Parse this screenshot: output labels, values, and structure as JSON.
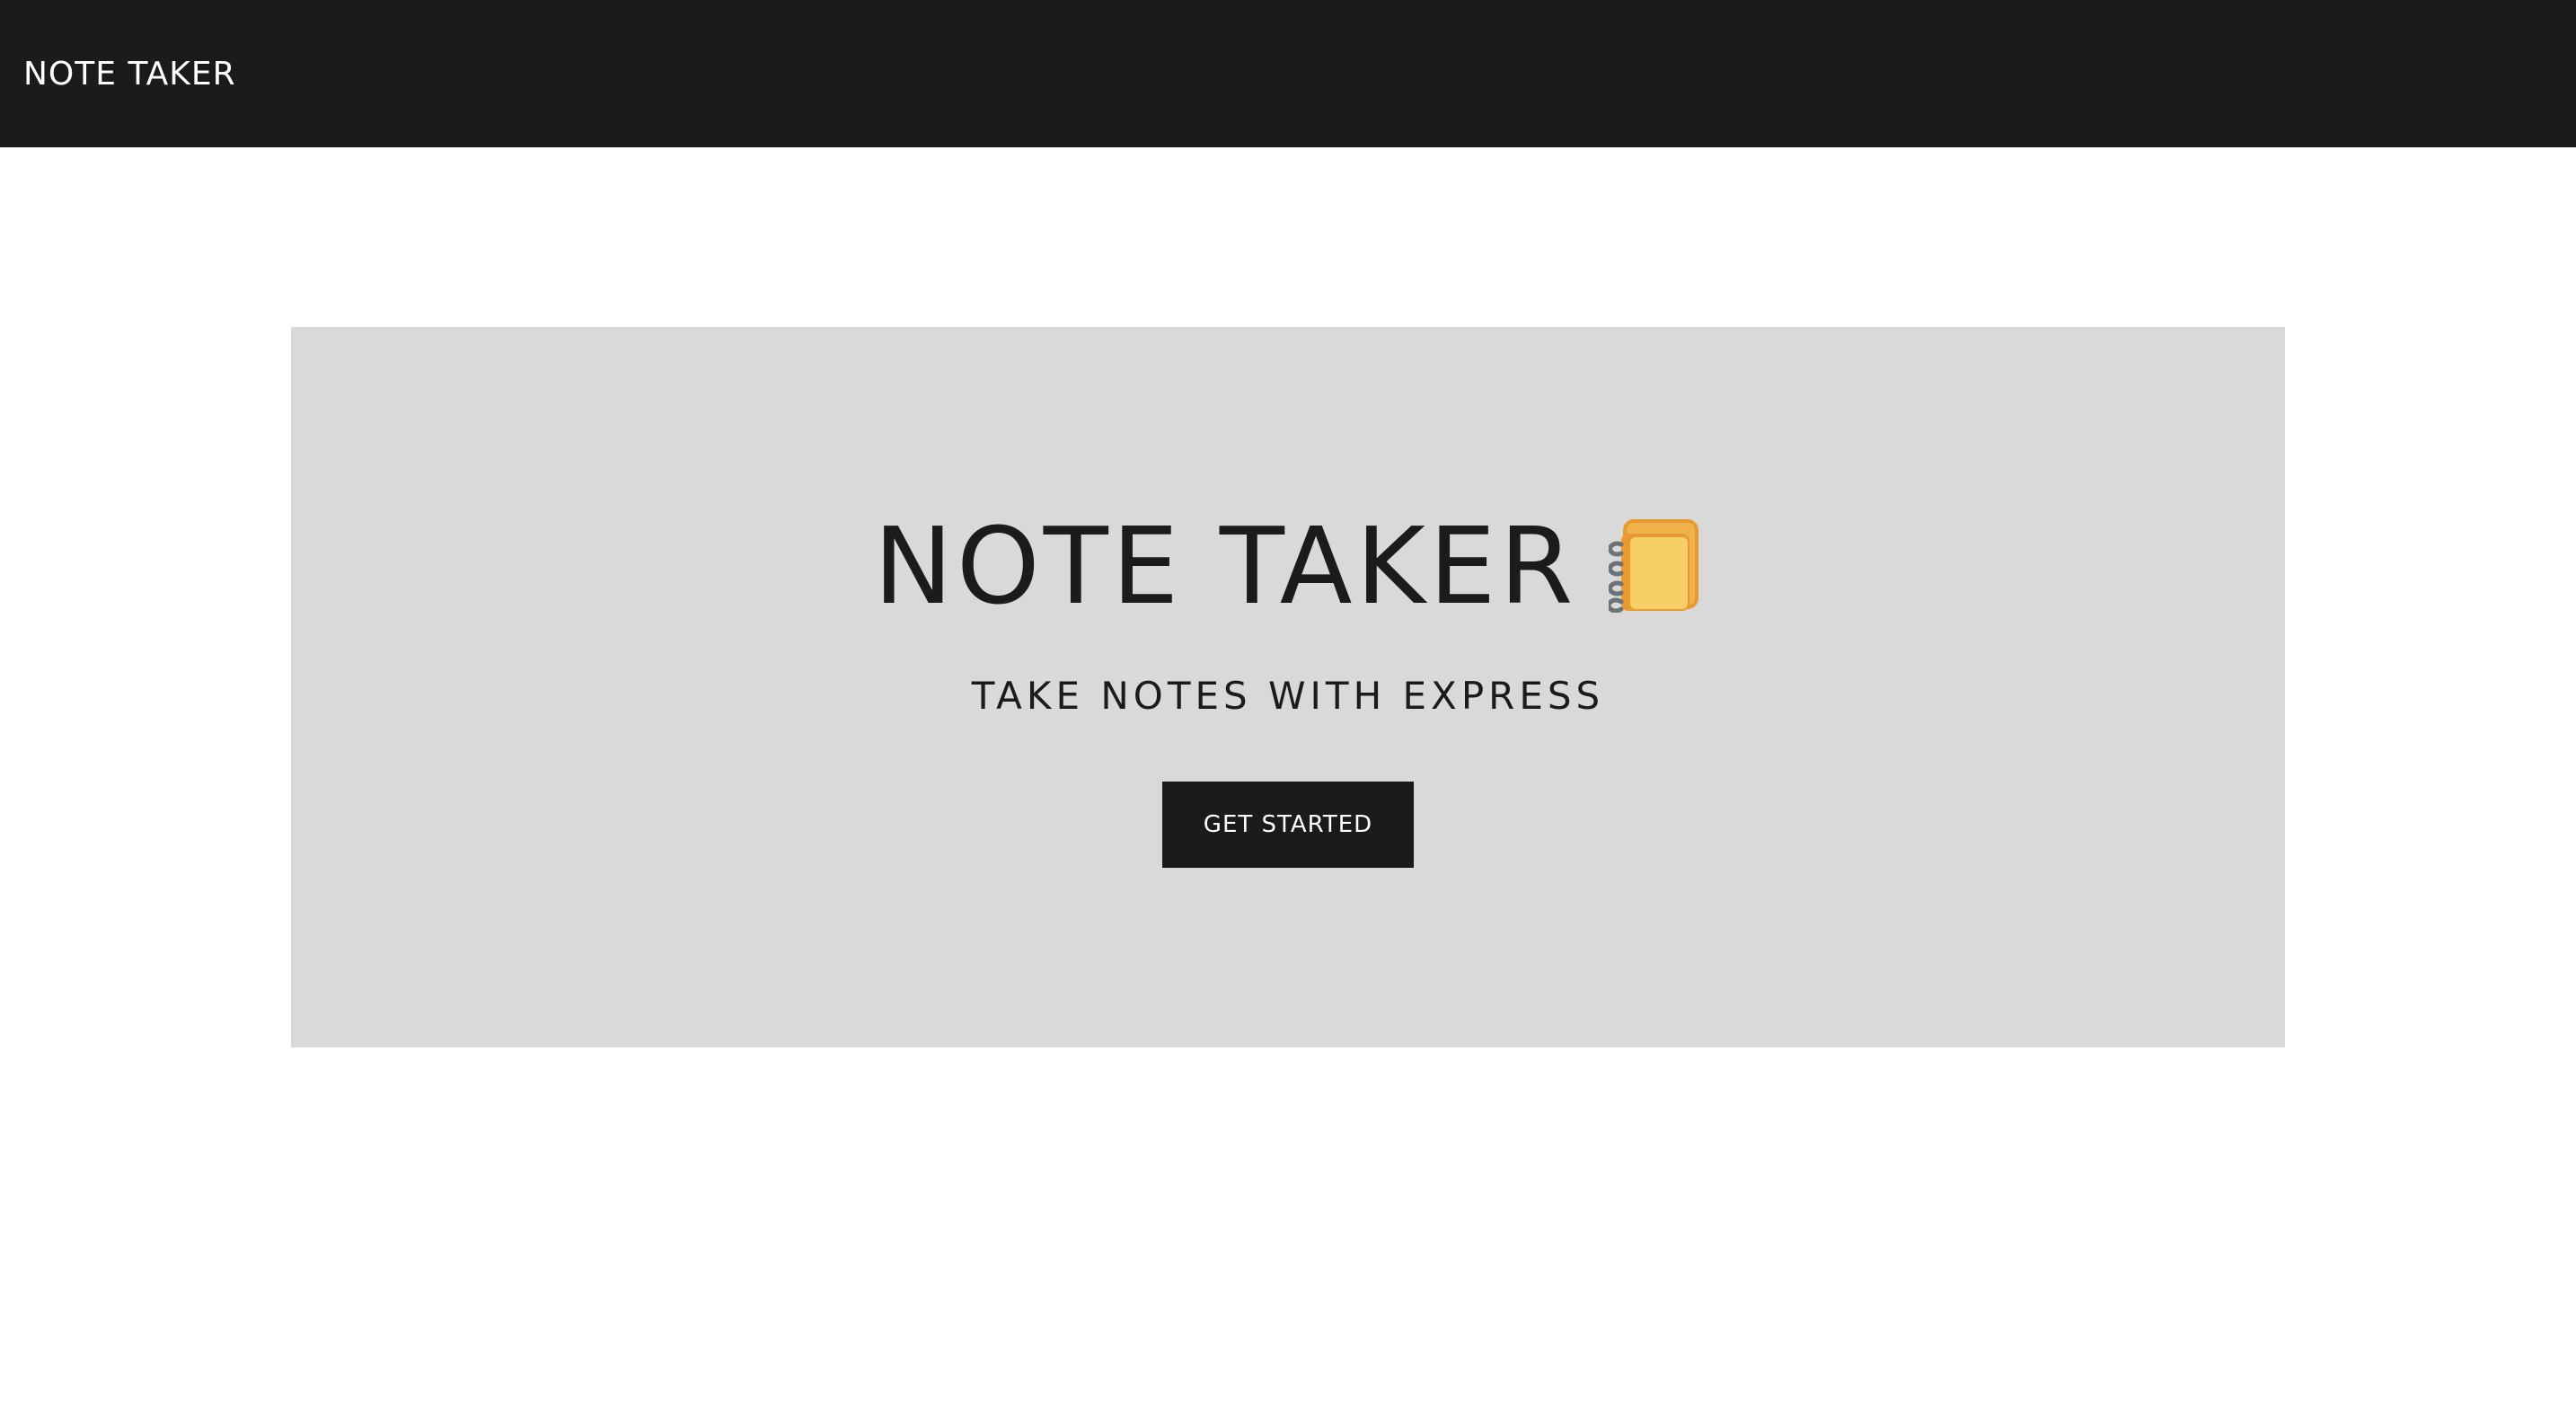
{
  "navbar": {
    "brand": "NOTE TAKER"
  },
  "hero": {
    "title": "NOTE TAKER",
    "icon": "notebook-icon",
    "subtitle": "TAKE NOTES WITH EXPRESS",
    "button_label": "GET STARTED"
  },
  "colors": {
    "navbar_bg": "#1b1b1b",
    "hero_bg": "#d9d9d9",
    "button_bg": "#1b1b1b",
    "icon_cover": "#f5c55a",
    "icon_outline": "#e89a30",
    "icon_rings": "#6b7278"
  }
}
